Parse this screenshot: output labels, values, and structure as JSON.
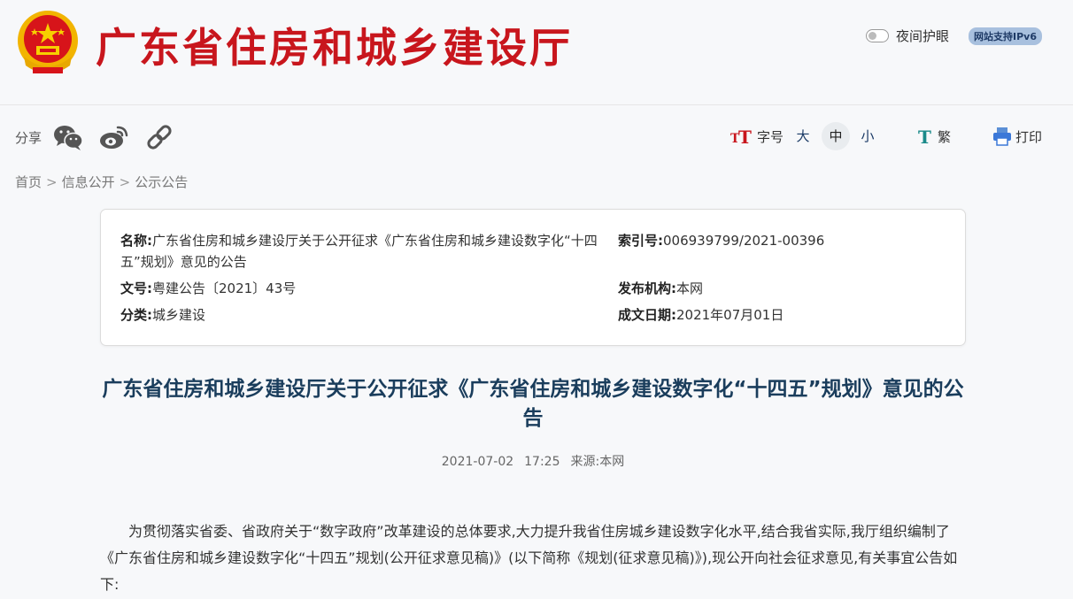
{
  "header": {
    "site_title": "广东省住房和城乡建设厅",
    "night_mode_label": "夜间护眼",
    "ipv6_badge": "网站支持IPv6",
    "colors": {
      "brand_red": "#c8161d",
      "emblem_gold": "#f2b400"
    }
  },
  "toolbar": {
    "share_label": "分享",
    "share_icons": [
      "wechat-icon",
      "weibo-icon",
      "link-icon"
    ],
    "font_size_label": "字号",
    "font_sizes": [
      "大",
      "中",
      "小"
    ],
    "font_size_selected": "中",
    "traditional_label": "繁",
    "print_label": "打印"
  },
  "breadcrumb": [
    "首页",
    "信息公开",
    "公示公告"
  ],
  "breadcrumb_sep": ">",
  "meta": {
    "name_label": "名称:",
    "name_value": "广东省住房和城乡建设厅关于公开征求《广东省住房和城乡建设数字化“十四五”规划》意见的公告",
    "index_label": "索引号:",
    "index_value": "006939799/2021-00396",
    "doc_no_label": "文号:",
    "doc_no_value": "粤建公告〔2021〕43号",
    "publisher_label": "发布机构:",
    "publisher_value": "本网",
    "category_label": "分类:",
    "category_value": "城乡建设",
    "date_label": "成文日期:",
    "date_value": "2021年07月01日"
  },
  "article": {
    "title": "广东省住房和城乡建设厅关于公开征求《广东省住房和城乡建设数字化“十四五”规划》意见的公告",
    "date": "2021-07-02",
    "time": "17:25",
    "source": "来源:本网",
    "body": "为贯彻落实省委、省政府关于“数字政府”改革建设的总体要求,大力提升我省住房城乡建设数字化水平,结合我省实际,我厅组织编制了《广东省住房和城乡建设数字化“十四五”规划(公开征求意见稿)》(以下简称《规划(征求意见稿)》),现公开向社会征求意见,有关事宜公告如下:"
  }
}
